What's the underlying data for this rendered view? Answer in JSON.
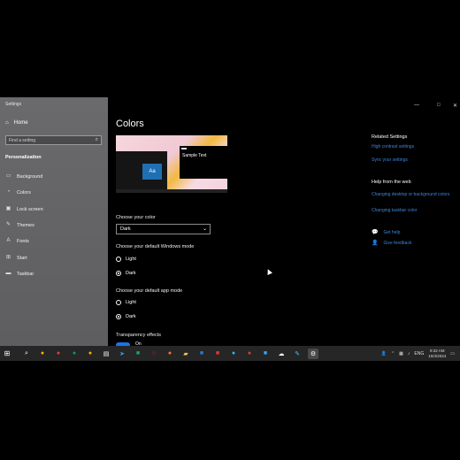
{
  "window": {
    "title": "Settings",
    "minimize": "—",
    "maximize": "□",
    "close": "✕"
  },
  "sidebar": {
    "home": "Home",
    "search_placeholder": "Find a setting",
    "section": "Personalization",
    "items": [
      {
        "label": "Background",
        "icon": "image-icon"
      },
      {
        "label": "Colors",
        "icon": "palette-icon"
      },
      {
        "label": "Lock screen",
        "icon": "lock-screen-icon"
      },
      {
        "label": "Themes",
        "icon": "brush-icon"
      },
      {
        "label": "Fonts",
        "icon": "font-icon"
      },
      {
        "label": "Start",
        "icon": "start-icon"
      },
      {
        "label": "Taskbar",
        "icon": "taskbar-icon"
      }
    ]
  },
  "main": {
    "title": "Colors",
    "preview": {
      "tile": "Aa",
      "sample_text": "Sample Text"
    },
    "choose_color": {
      "label": "Choose your color",
      "value": "Dark"
    },
    "windows_mode": {
      "label": "Choose your default Windows mode",
      "options": [
        "Light",
        "Dark"
      ],
      "selected": "Dark"
    },
    "app_mode": {
      "label": "Choose your default app mode",
      "options": [
        "Light",
        "Dark"
      ],
      "selected": "Dark"
    },
    "transparency": {
      "label": "Transparency effects",
      "state": "On"
    }
  },
  "related": {
    "heading": "Related Settings",
    "links": [
      "High contrast settings",
      "Sync your settings"
    ],
    "help_heading": "Help from the web",
    "help_links": [
      "Changing desktop or background colors",
      "Changing taskbar color"
    ],
    "get_help": "Get help",
    "feedback": "Give feedback"
  },
  "taskbar": {
    "time": "9:32 AM",
    "date": "10/4/2024",
    "lang": "ENG",
    "apps": [
      "chrome",
      "chrome",
      "chrome",
      "chrome",
      "notepad",
      "telegram",
      "excel",
      "opera",
      "firefox",
      "explorer",
      "word",
      "media",
      "edge",
      "powerpoint",
      "photoshop",
      "onedrive",
      "paint",
      "settings"
    ]
  },
  "colors": {
    "accent": "#1a73e8",
    "link": "#3b86d9",
    "sidebar": "#646466"
  }
}
